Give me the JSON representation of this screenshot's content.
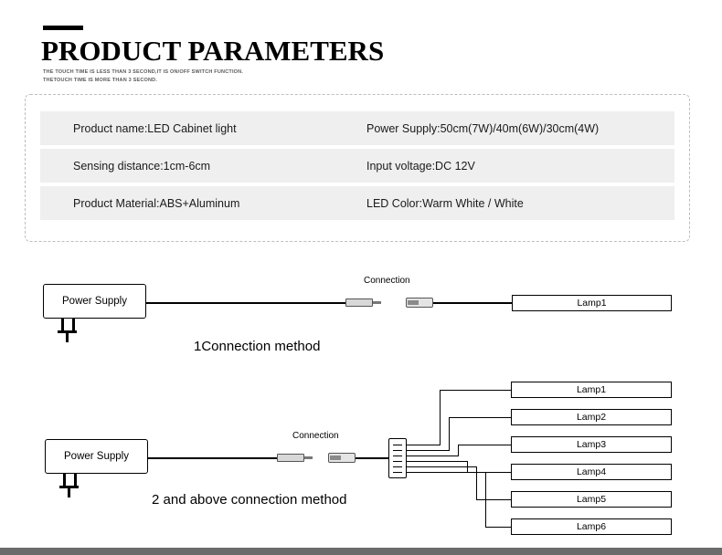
{
  "header": {
    "title": "PRODUCT PARAMETERS",
    "subtitle_line1": "THE TOUCH TIME IS LESS THAN 3 SECOND,IT IS ON/OFF SWITCH FUNCTION.",
    "subtitle_line2": "THETOUCH TIME IS MORE THAN 3 SECOND."
  },
  "specs": {
    "rows": [
      {
        "left": "Product name:LED Cabinet light",
        "right": "Power Supply:50cm(7W)/40m(6W)/30cm(4W)"
      },
      {
        "left": "Sensing distance:1cm-6cm",
        "right": "Input voltage:DC 12V"
      },
      {
        "left": "Product Material:ABS+Aluminum",
        "right": "LED Color:Warm White / White"
      }
    ]
  },
  "diagram1": {
    "power_supply_label": "Power Supply",
    "connection_label": "Connection",
    "lamp_label": "Lamp1",
    "caption": "1Connection method"
  },
  "diagram2": {
    "power_supply_label": "Power Supply",
    "connection_label": "Connection",
    "caption": "2 and above connection method",
    "lamps": [
      "Lamp1",
      "Lamp2",
      "Lamp3",
      "Lamp4",
      "Lamp5",
      "Lamp6"
    ]
  },
  "colors": {
    "row_background": "#efefef",
    "line": "#000000",
    "bottom_bar": "#6b6b6b"
  }
}
